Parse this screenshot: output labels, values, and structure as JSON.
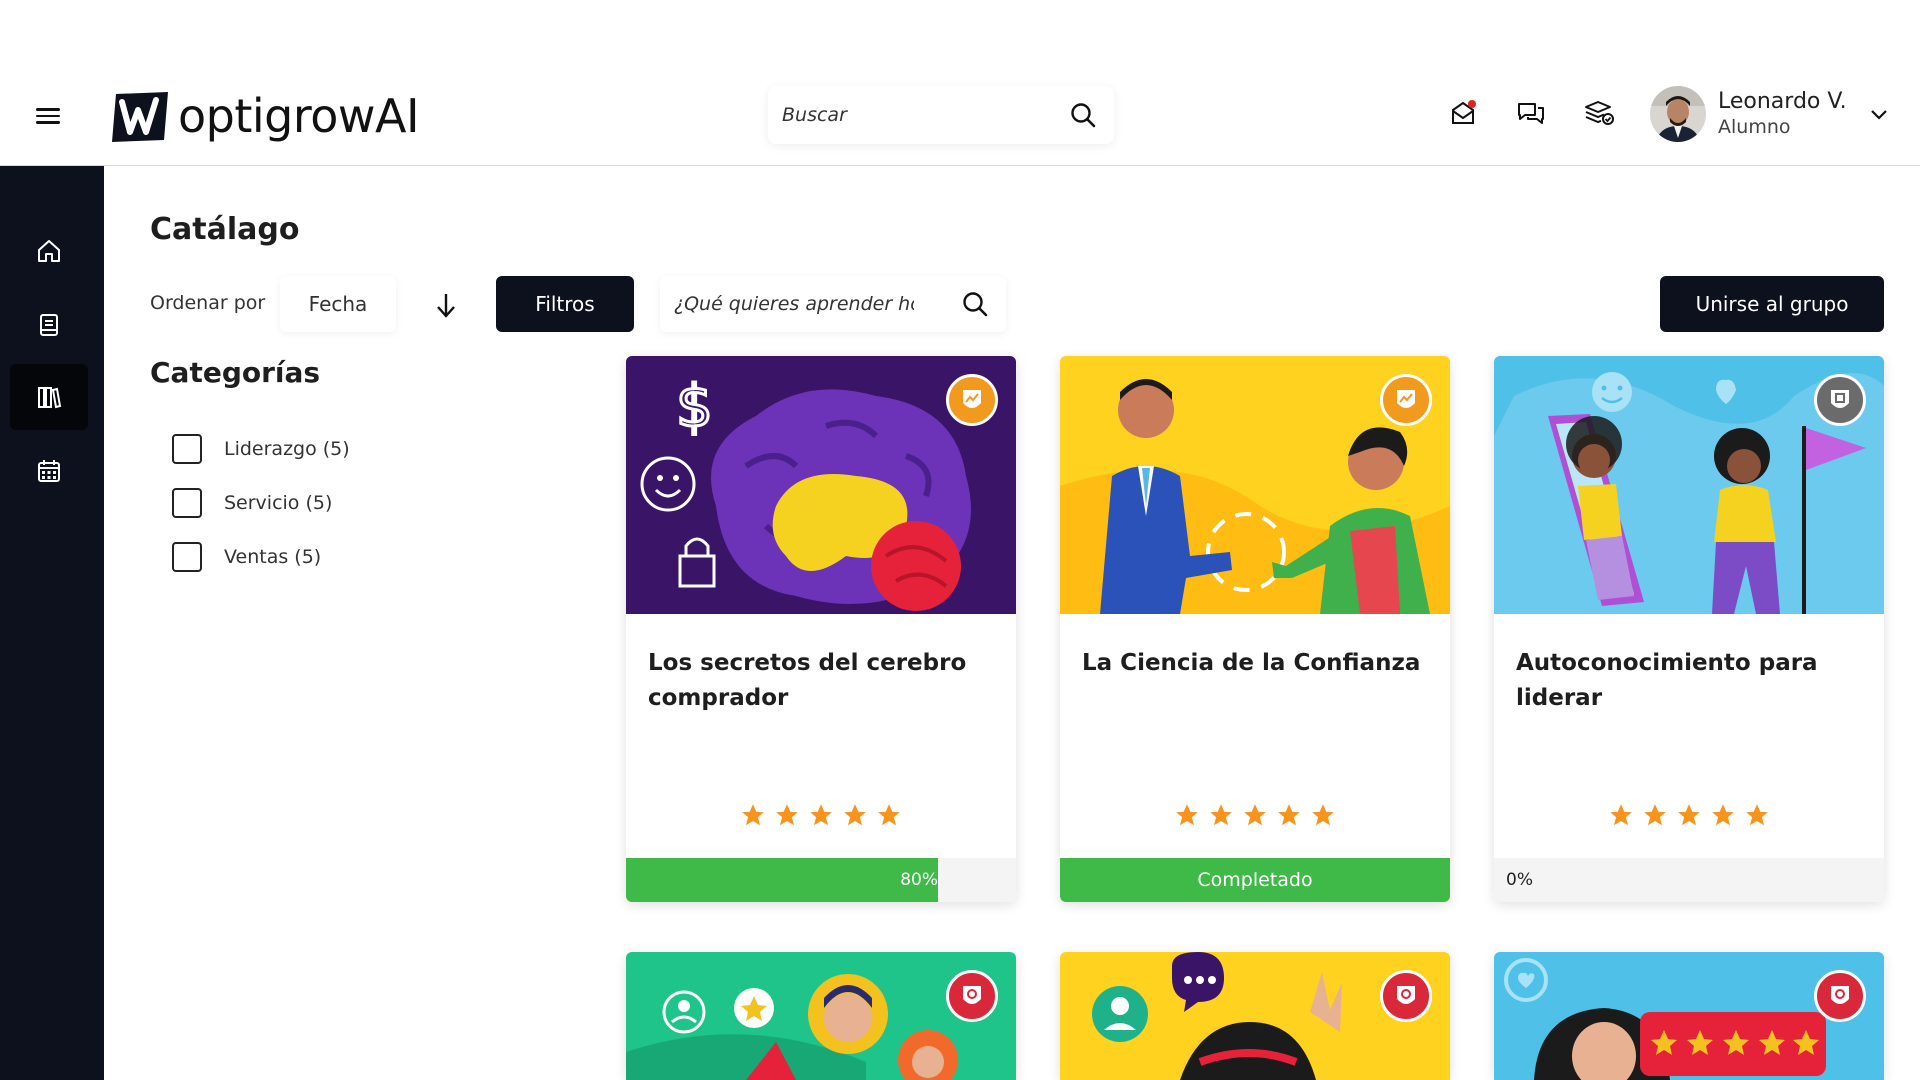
{
  "app": {
    "logo_text": "optigrowAI",
    "search_placeholder": "Buscar"
  },
  "user": {
    "name": "Leonardo V.",
    "role": "Alumno"
  },
  "header_icons": [
    "mail-notification-icon",
    "chat-icon",
    "courses-stack-icon"
  ],
  "sidebar": {
    "items": [
      {
        "name": "home-icon",
        "active": false
      },
      {
        "name": "book-icon",
        "active": false
      },
      {
        "name": "library-icon",
        "active": true
      },
      {
        "name": "calendar-icon",
        "active": false
      }
    ]
  },
  "catalog": {
    "title": "Catálago",
    "sort_label": "Ordenar por",
    "sort_value": "Fecha",
    "filters_label": "Filtros",
    "search_placeholder": "¿Qué quieres aprender hoy?",
    "join_label": "Unirse al grupo"
  },
  "categories": {
    "title": "Categorías",
    "items": [
      {
        "label": "Liderazgo (5)",
        "checked": false
      },
      {
        "label": "Servicio (5)",
        "checked": false
      },
      {
        "label": "Ventas (5)",
        "checked": false
      }
    ]
  },
  "courses": [
    {
      "title": "Los secretos del cerebro comprador",
      "rating": 5,
      "progress": 80,
      "progress_label": "80%",
      "badge_color": "#f29a1e"
    },
    {
      "title": "La Ciencia de la Confianza",
      "rating": 5,
      "progress": 100,
      "progress_label": "Completado",
      "badge_color": "#f29a1e"
    },
    {
      "title": "Autoconocimiento para liderar",
      "rating": 5,
      "progress": 0,
      "progress_label": "0%",
      "badge_color": "#6b6b6b"
    }
  ],
  "colors": {
    "dark": "#0d111d",
    "progress": "#3fba48",
    "star": "#f7941d"
  }
}
